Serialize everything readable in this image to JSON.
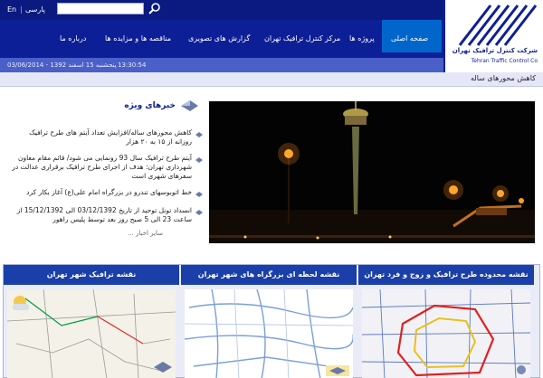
{
  "header": {
    "lang_en": "En",
    "lang_sep": "|",
    "lang_fa": "پارسی",
    "search_placeholder": "",
    "nav": [
      {
        "label": "صفحه اصلی"
      },
      {
        "label": "پروژه ها"
      },
      {
        "label": "مرکز کنترل ترافیک تهران"
      },
      {
        "label": "گزارش های تصویری"
      },
      {
        "label": "مناقصه ها و مزایده ها"
      },
      {
        "label": "درباره ما"
      }
    ],
    "logo_fa": "شرکت کنترل ترافیک تهران",
    "logo_en": "Tehran Traffic Control Co",
    "date_fa": "پنجشنبه 15 اسفند 1392 - 03/06/2014",
    "time": "13:30:54"
  },
  "ticker": {
    "text": "کاهش محورهای ساله"
  },
  "news": {
    "title": "خبرهای ویژه",
    "items": [
      "کاهش محورهای ساله/افزایش تعداد آیتم های طرح ترافیک روزانه از ۱۵ به ۲۰ هزار",
      "آیتم طرح ترافیک سال 93 رونمایی می شود/ قائم مقام معاون شهرداری تهران: هدف از اجرای طرح ترافیک برقراری عدالت در سفرهای شهری است",
      "خط اتوبوسهای تندرو در بزرگراه امام علی(ع) آغاز بکار کرد",
      "انسداد تونل توحید از تاریخ 03/12/1392 الی 15/12/1392 از ساعت 23 الی 5 صبح روز بعد توسط پلیس راهور"
    ],
    "more": "سایر اخبار ..."
  },
  "maps": [
    {
      "title": "نقشه ترافیک شهر تهران"
    },
    {
      "title": "نقشه لحظه ای بزرگراه های شهر تهران"
    },
    {
      "title": "نقشه محدوده طرح ترافیک و زوج و فرد تهران"
    }
  ],
  "colors": {
    "header_bg": "#0d1f96",
    "nav_active": "#0066cc",
    "panel_head": "#1a3fa8"
  }
}
